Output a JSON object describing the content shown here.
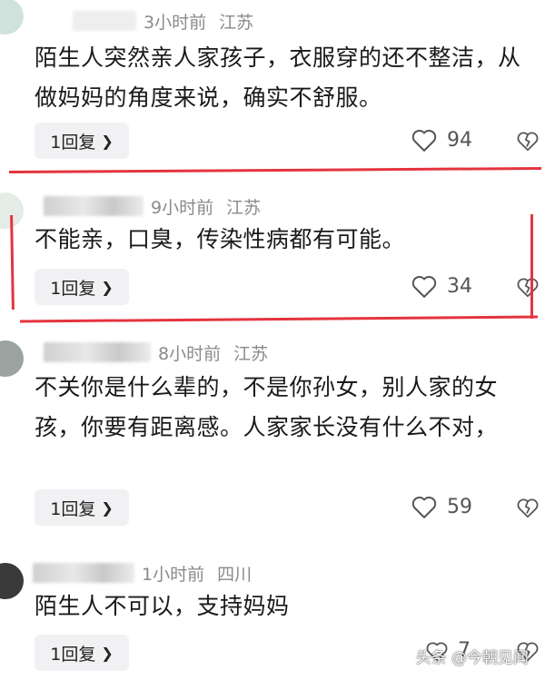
{
  "comments": [
    {
      "time": "3小时前",
      "location": "江苏",
      "text": "陌生人突然亲人家孩子，衣服穿的还不整洁，从做妈妈的角度来说，确实不舒服。",
      "reply_label": "1回复",
      "likes": "94"
    },
    {
      "time": "9小时前",
      "location": "江苏",
      "text": "不能亲，口臭，传染性病都有可能。",
      "reply_label": "1回复",
      "likes": "34"
    },
    {
      "time": "8小时前",
      "location": "江苏",
      "text": "不关你是什么辈的，不是你孙女，别人家的女孩，你要有距离感。人家家长没有什么不对，",
      "reply_label": "1回复",
      "likes": "59"
    },
    {
      "time": "1小时前",
      "location": "四川",
      "text": "陌生人不可以，支持妈妈",
      "reply_label": "1回复",
      "likes": "7"
    }
  ],
  "icons": {
    "like": "heart-outline-icon",
    "dislike": "broken-heart-icon",
    "reply_chevron": "chevron-right-icon"
  },
  "colors": {
    "highlight": "#e4343f",
    "meta_text": "#8a8a8a",
    "reply_bg": "#f1f1f3"
  },
  "watermark": "头条 @今朝见闻"
}
